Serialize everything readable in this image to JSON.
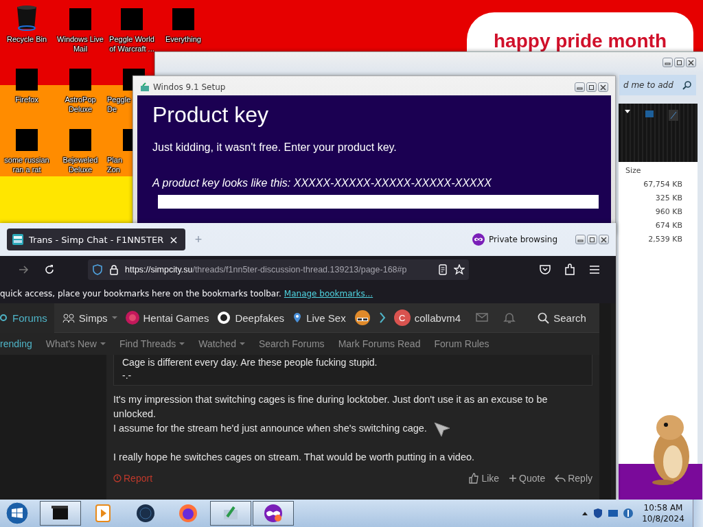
{
  "desktop": {
    "banner": "happy pride month",
    "icons": [
      {
        "label": "Recycle Bin",
        "kind": "bin"
      },
      {
        "label": "Windows Live Mail",
        "kind": "censored"
      },
      {
        "label": "Peggle World of Warcraft ...",
        "kind": "censored"
      },
      {
        "label": "Everything",
        "kind": "censored"
      },
      {
        "label": "Firefox",
        "kind": "censored"
      },
      {
        "label": "AstroPop Deluxe",
        "kind": "censored"
      },
      {
        "label": "Peggle De",
        "kind": "censored"
      },
      {
        "label": "some russian ran a rat",
        "kind": "censored"
      },
      {
        "label": "Bejeweled Deluxe",
        "kind": "censored"
      },
      {
        "label": "Plan Zon",
        "kind": "censored"
      }
    ]
  },
  "explorer": {
    "search": "d me to add",
    "column": "Size",
    "sizes": [
      "67,754 KB",
      "325 KB",
      "960 KB",
      "674 KB",
      "2,539 KB"
    ]
  },
  "setup": {
    "title": "Windos 9.1 Setup",
    "heading": "Product key",
    "text": "Just kidding, it wasn't free. Enter your product key.",
    "hint": "A product key looks like this: XXXXX-XXXXX-XXXXX-XXXXX-XXXXX"
  },
  "browser": {
    "tab": {
      "title": "Trans - Simp Chat - F1NN5TER",
      "close": "×",
      "selected": true
    },
    "new_tab": "+",
    "private": "Private browsing",
    "url": {
      "host": "https://simpcity.su",
      "path": "/threads/f1nn5ter-discussion-thread.139213/page-168#p"
    },
    "bookmarks_text": "quick access, place your bookmarks here on the bookmarks toolbar.",
    "bookmarks_link": "Manage bookmarks...",
    "nav": [
      {
        "label": "Forums",
        "kind": "forums",
        "dropdown": false,
        "selected": true
      },
      {
        "label": "Simps",
        "kind": "people",
        "dropdown": true,
        "selected": false
      },
      {
        "label": "Hentai Games",
        "kind": "pink",
        "dropdown": false,
        "selected": false
      },
      {
        "label": "Deepfakes",
        "kind": "ring",
        "dropdown": false,
        "selected": false
      },
      {
        "label": "Live Sex",
        "kind": "pin",
        "dropdown": false,
        "selected": false
      }
    ],
    "user": {
      "initial": "C",
      "name": "collabvm4"
    },
    "search": "Search",
    "subnav": [
      {
        "label": "rending",
        "dropdown": false,
        "selected": true
      },
      {
        "label": "What's New",
        "dropdown": true,
        "selected": false
      },
      {
        "label": "Find Threads",
        "dropdown": true,
        "selected": false
      },
      {
        "label": "Watched",
        "dropdown": true,
        "selected": false
      },
      {
        "label": "Search Forums",
        "dropdown": false,
        "selected": false
      },
      {
        "label": "Mark Forums Read",
        "dropdown": false,
        "selected": false
      },
      {
        "label": "Forum Rules",
        "dropdown": false,
        "selected": false
      }
    ],
    "quote": [
      "Cage is different every day. Are these people fucking stupid.",
      "-.-"
    ],
    "post": [
      [
        "It's my impression that switching cages is fine during locktober. Just don't use it as an excuse to be unlocked.",
        "I assume for the stream he'd just announce when she's switching cage."
      ],
      [
        "I really hope he switches cages on stream. That would be worth putting in a video."
      ]
    ],
    "actions": {
      "report": "Report",
      "like": "Like",
      "quote": "Quote",
      "reply": "Reply"
    }
  },
  "taskbar": {
    "tasks": [
      {
        "kind": "black",
        "open": true
      },
      {
        "kind": "media",
        "open": false
      },
      {
        "kind": "globe",
        "open": false
      },
      {
        "kind": "firefox",
        "open": false
      },
      {
        "kind": "setup",
        "open": true
      },
      {
        "kind": "private",
        "open": true
      }
    ],
    "time": "10:58 AM",
    "date": "10/8/2024"
  }
}
